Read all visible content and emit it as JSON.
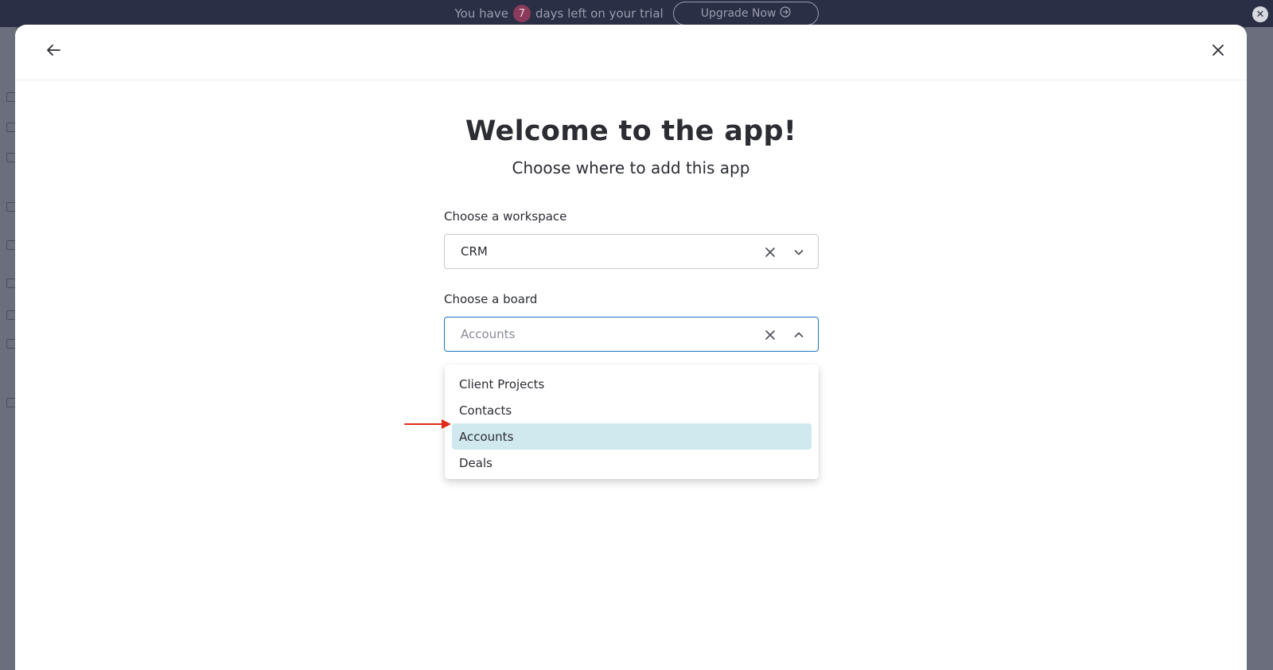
{
  "banner": {
    "prefix": "You have",
    "days": "7",
    "suffix": "days left on your trial",
    "upgrade_label": "Upgrade Now"
  },
  "modal": {
    "title": "Welcome to the app!",
    "subtitle": "Choose where to add this app",
    "workspace": {
      "label": "Choose a workspace",
      "value": "CRM"
    },
    "board": {
      "label": "Choose a board",
      "placeholder": "Accounts",
      "options": [
        "Client Projects",
        "Contacts",
        "Accounts",
        "Deals"
      ],
      "selected": "Accounts"
    }
  },
  "colors": {
    "banner_bg": "#2b2f45",
    "accent_focus": "#1f76c2",
    "selected_option_bg": "#d0e9ee",
    "annotation_arrow": "#e02a1a"
  },
  "icons": {
    "back": "arrow-left-icon",
    "close": "close-icon",
    "clear": "clear-x-icon",
    "chevron_down": "chevron-down-icon",
    "chevron_up": "chevron-up-icon",
    "upgrade_arrow": "circle-arrow-right-icon"
  }
}
